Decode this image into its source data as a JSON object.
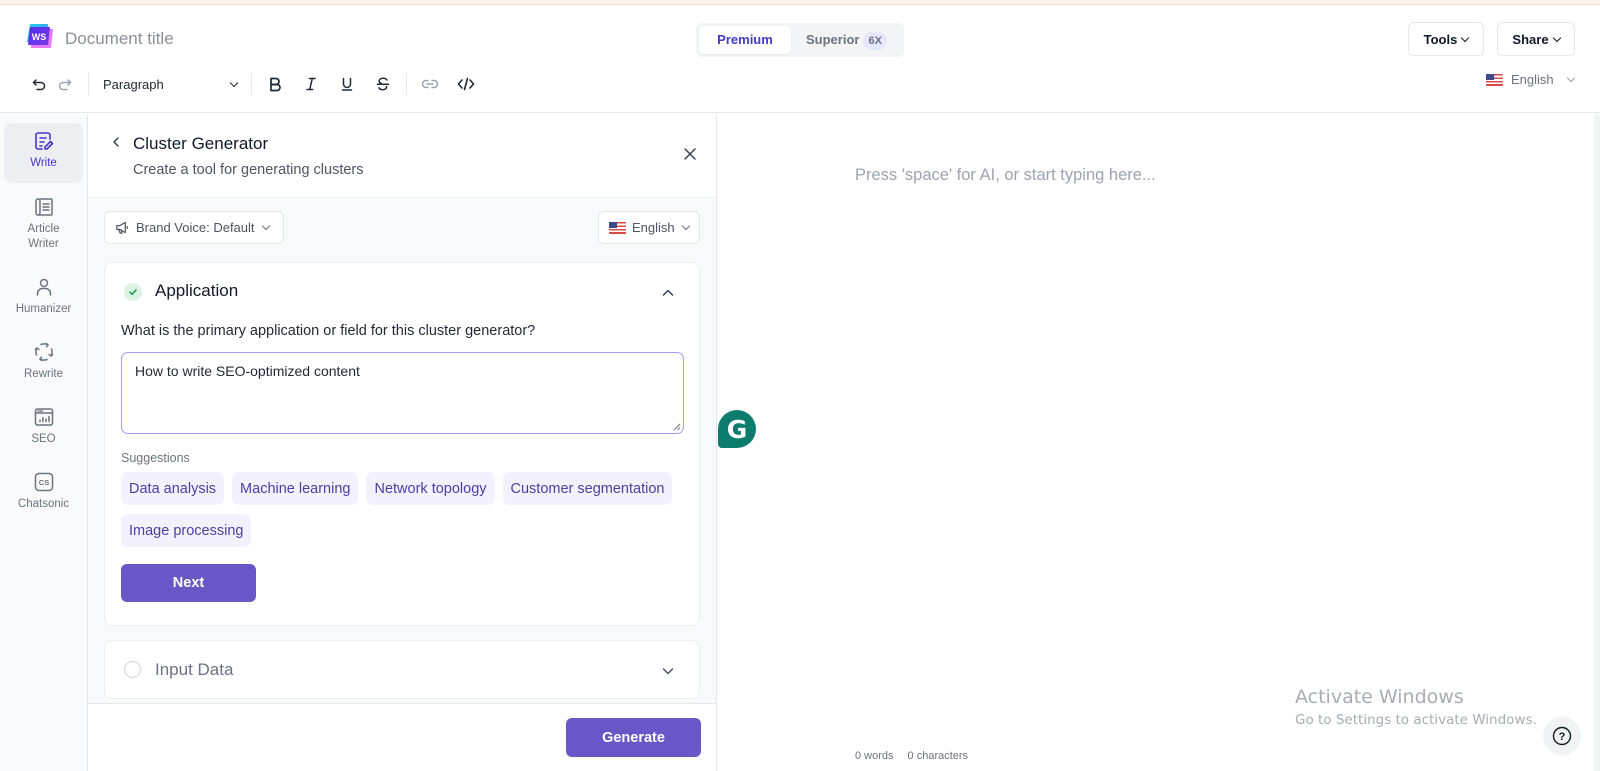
{
  "header": {
    "logo_text": "WS",
    "document_title": "Document title",
    "plan_toggle": {
      "options": [
        {
          "label": "Premium",
          "selected": true
        },
        {
          "label": "Superior",
          "badge": "6X",
          "selected": false
        }
      ]
    },
    "tools_label": "Tools",
    "share_label": "Share",
    "language": "English"
  },
  "toolbar": {
    "block_format": "Paragraph",
    "icons": [
      "undo-icon",
      "redo-icon",
      "bold-icon",
      "italic-icon",
      "underline-icon",
      "strikethrough-icon",
      "link-icon",
      "code-icon"
    ]
  },
  "sidebar": {
    "items": [
      {
        "label": "Write",
        "icon": "write-icon",
        "active": true
      },
      {
        "label": "Article Writer",
        "icon": "article-writer-icon",
        "active": false
      },
      {
        "label": "Humanizer",
        "icon": "person-icon",
        "active": false
      },
      {
        "label": "Rewrite",
        "icon": "rewrite-icon",
        "active": false
      },
      {
        "label": "SEO",
        "icon": "seo-chart-icon",
        "active": false
      },
      {
        "label": "Chatsonic",
        "icon": "chatsonic-icon",
        "active": false
      }
    ]
  },
  "panel": {
    "title": "Cluster Generator",
    "subtitle": "Create a tool for generating clusters",
    "brand_voice": "Brand Voice: Default",
    "language": "English",
    "steps": [
      {
        "title": "Application",
        "status": "complete",
        "expanded": true,
        "question": "What is the primary application or field for this cluster generator?",
        "value": "How to write SEO-optimized content",
        "suggestions_label": "Suggestions",
        "suggestions": [
          "Data analysis",
          "Machine learning",
          "Network topology",
          "Customer segmentation",
          "Image processing"
        ],
        "next_label": "Next"
      },
      {
        "title": "Input Data",
        "status": "pending",
        "expanded": false
      }
    ],
    "generate_label": "Generate"
  },
  "editor": {
    "placeholder": "Press 'space' for AI, or start typing here...",
    "word_count": "0 words",
    "char_count": "0 characters"
  },
  "overlays": {
    "grammarly_letter": "G",
    "activate_title": "Activate Windows",
    "activate_sub": "Go to Settings to activate Windows.",
    "help_symbol": "?"
  },
  "colors": {
    "accent": "#6a57c7",
    "accent_text": "#4338ca",
    "chip_bg": "#f3f1fe",
    "chip_text": "#4c3fa3",
    "success_bg": "#dcf2e4",
    "success": "#22a05a",
    "grammarly": "#0c7d6c"
  }
}
